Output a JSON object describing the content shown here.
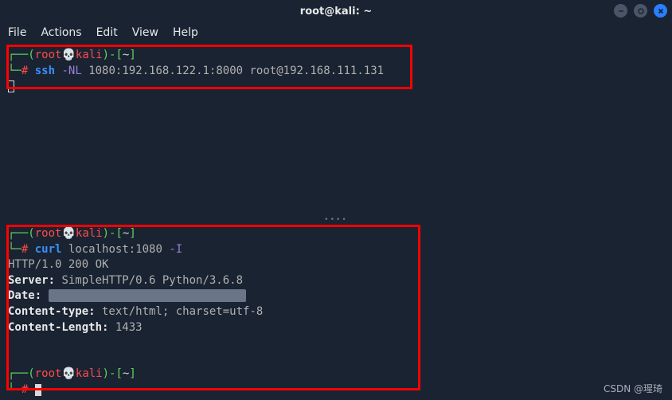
{
  "titlebar": {
    "title": "root@kali: ~"
  },
  "menubar": {
    "file": "File",
    "actions": "Actions",
    "edit": "Edit",
    "view": "View",
    "help": "Help"
  },
  "prompt": {
    "open_paren": "(",
    "user": "root",
    "skull": "💀",
    "host": "kali",
    "close_paren": ")",
    "dash": "-",
    "bracket_open": "[",
    "path": "~",
    "bracket_close": "]",
    "hash": "#"
  },
  "pane_top": {
    "command_parts": {
      "cmd": "ssh",
      "flag": "-NL",
      "args": "1080:192.168.122.1:8000 root@192.168.111.131"
    }
  },
  "pane_bottom": {
    "command_parts": {
      "cmd": "curl",
      "target": "localhost:1080",
      "flag": "-I"
    },
    "output": {
      "status": "HTTP/1.0 200 OK",
      "server_label": "Server:",
      "server_value": " SimpleHTTP/0.6 Python/3.6.8",
      "date_label": "Date:",
      "date_value_blurred": "███, ██ ███ ████ ██:██:██ ███",
      "ctype_label": "Content-type:",
      "ctype_value": " text/html; charset=utf-8",
      "clen_label": "Content-Length:",
      "clen_value": " 1433"
    }
  },
  "watermark": "CSDN @瑆琦"
}
